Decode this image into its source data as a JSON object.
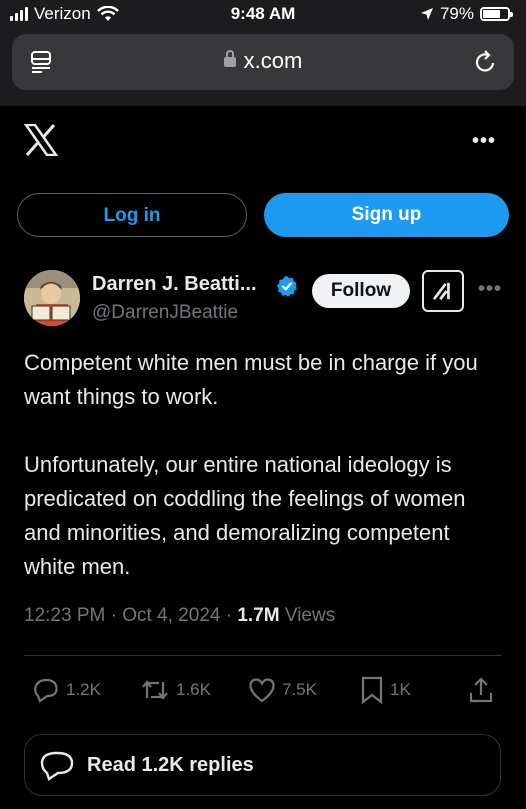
{
  "status_bar": {
    "carrier": "Verizon",
    "time": "9:48 AM",
    "battery_percent": "79%",
    "battery_level": 0.79,
    "icons": [
      "signal-icon",
      "wifi-icon",
      "location-arrow-icon",
      "battery-icon"
    ]
  },
  "browser": {
    "url": "x.com",
    "icons": [
      "tabs-icon",
      "lock-icon",
      "reload-icon"
    ]
  },
  "header": {
    "logo": "x-logo-icon",
    "more": "•••"
  },
  "auth": {
    "login_label": "Log in",
    "signup_label": "Sign up"
  },
  "tweet": {
    "author_name": "Darren J. Beatti...",
    "handle": "@DarrenJBeattie",
    "verified": true,
    "follow_label": "Follow",
    "more": "•••",
    "text": "Competent white men must be in charge if you want things to work.\n\nUnfortunately, our entire national ideology is predicated on coddling the feelings of women and minorities, and demoralizing competent white men.",
    "time": "12:23 PM",
    "separator": "·",
    "date": "Oct 4, 2024",
    "views_count": "1.7M",
    "views_label": "Views"
  },
  "actions": {
    "replies": "1.2K",
    "reposts": "1.6K",
    "likes": "7.5K",
    "bookmarks": "1K"
  },
  "read_replies_label": "Read 1.2K replies",
  "colors": {
    "accent": "#1d9bf0",
    "background": "#000000",
    "text": "#e7e9ea",
    "muted": "#71767b"
  }
}
